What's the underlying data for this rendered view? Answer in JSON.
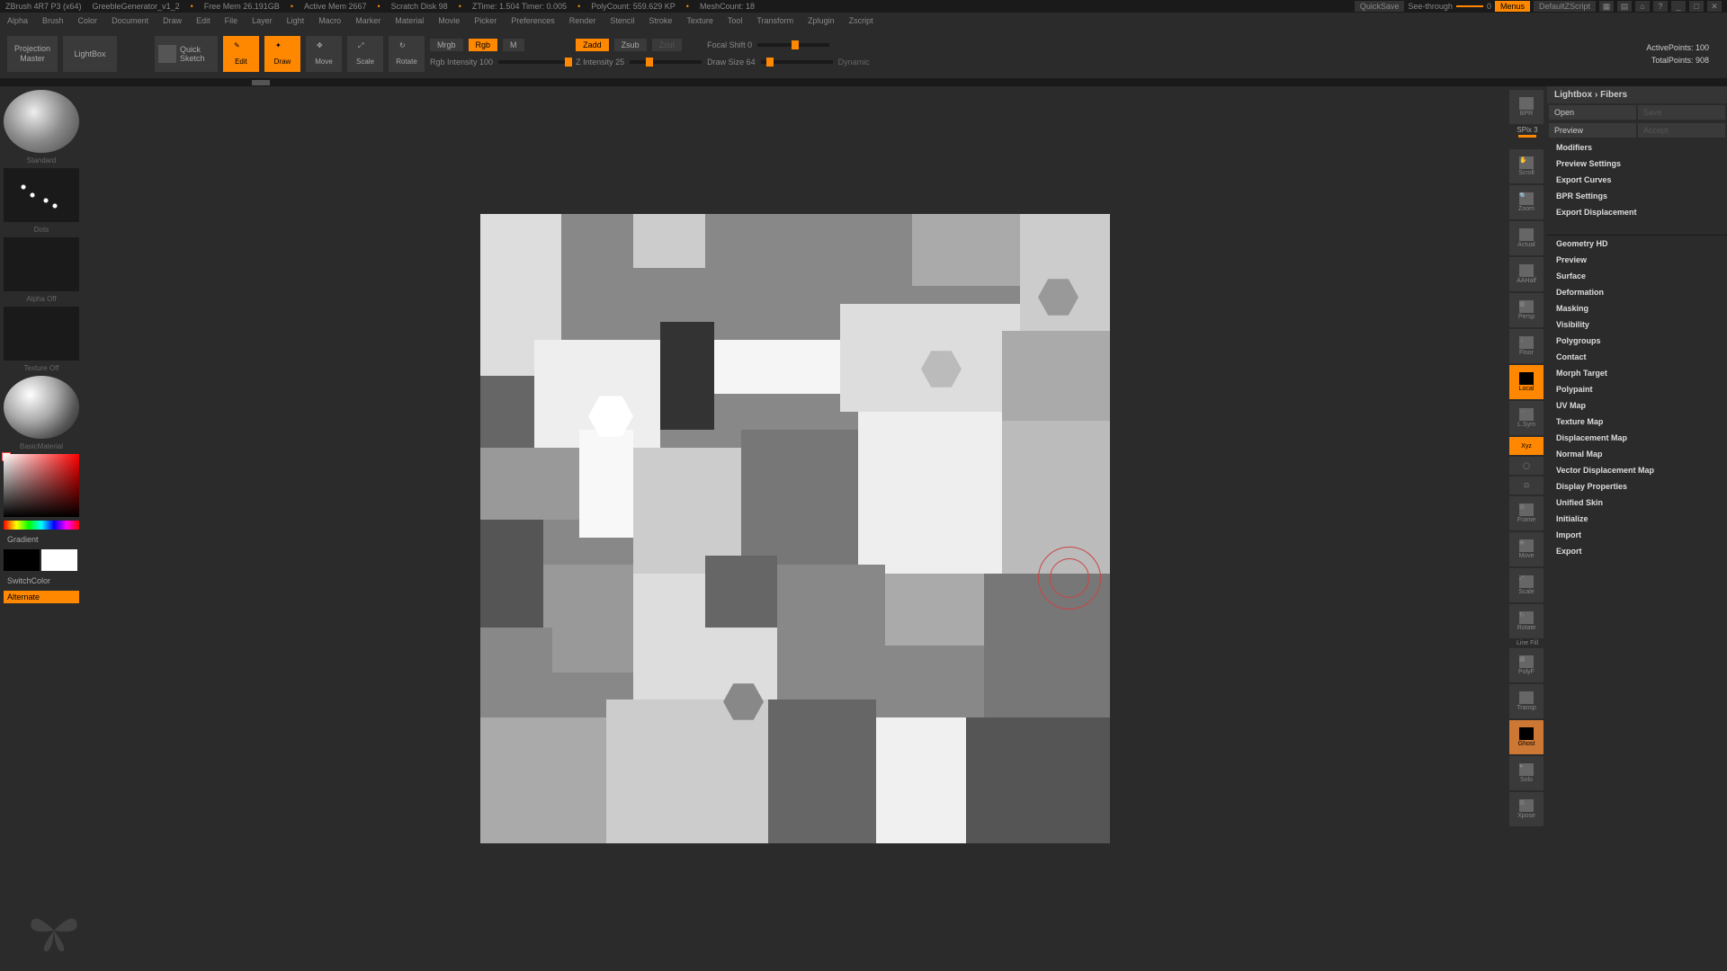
{
  "titlebar": {
    "app": "ZBrush 4R7 P3 (x64)",
    "project": "GreebleGenerator_v1_2",
    "free_mem": "Free Mem 26.191GB",
    "active_mem": "Active Mem 2667",
    "scratch": "Scratch Disk 98",
    "ztime": "ZTime: 1.504 Timer: 0.005",
    "polycount": "PolyCount: 559.629 KP",
    "meshcount": "MeshCount: 18",
    "quicksave": "QuickSave",
    "seethrough": "See-through",
    "seethrough_val": "0",
    "menus": "Menus",
    "script": "DefaultZScript"
  },
  "menu": [
    "Alpha",
    "Brush",
    "Color",
    "Document",
    "Draw",
    "Edit",
    "File",
    "Layer",
    "Light",
    "Macro",
    "Marker",
    "Material",
    "Movie",
    "Picker",
    "Preferences",
    "Render",
    "Stencil",
    "Stroke",
    "Texture",
    "Tool",
    "Transform",
    "Zplugin",
    "Zscript"
  ],
  "header": {
    "projection": "Projection\nMaster",
    "lightbox": "LightBox",
    "quicksketch": "Quick\nSketch",
    "modes": [
      "Edit",
      "Draw",
      "Move",
      "Scale",
      "Rotate"
    ],
    "mrgb": "Mrgb",
    "rgb": "Rgb",
    "m": "M",
    "rgb_intensity": "Rgb Intensity",
    "rgb_intensity_val": "100",
    "zadd": "Zadd",
    "zsub": "Zsub",
    "zcut": "Zcut",
    "z_intensity": "Z Intensity",
    "z_intensity_val": "25",
    "focal_shift": "Focal Shift",
    "focal_shift_val": "0",
    "draw_size": "Draw Size",
    "draw_size_val": "64",
    "dynamic": "Dynamic",
    "active_points": "ActivePoints:",
    "active_points_val": "100",
    "total_points": "TotalPoints:",
    "total_points_val": "908"
  },
  "left": {
    "brush": "Standard",
    "stroke": "Dots",
    "alpha": "Alpha Off",
    "texture": "Texture Off",
    "material": "BasicMaterial",
    "gradient": "Gradient",
    "switchcolor": "SwitchColor",
    "alternate": "Alternate"
  },
  "right_shelf": {
    "bpr": "BPR",
    "spix": "SPix",
    "spix_val": "3",
    "items": [
      "Scroll",
      "Zoom",
      "Actual",
      "AAHalf",
      "Persp",
      "Floor",
      "Local",
      "L.Sym",
      "Xyz",
      "",
      "",
      "Frame",
      "Move",
      "Scale",
      "Rotate",
      "Line Fill",
      "PolyF",
      "Transp",
      "Ghost",
      "Solo",
      "Xpose"
    ]
  },
  "right_panel": {
    "header": "Lightbox › Fibers",
    "open": "Open",
    "save": "Save",
    "preview": "Preview",
    "accept": "Accept",
    "modifiers": "Modifiers",
    "preview_settings": "Preview Settings",
    "export_curves": "Export Curves",
    "bpr_settings": "BPR Settings",
    "export_disp": "Export Displacement",
    "sections": [
      "Geometry HD",
      "Preview",
      "Surface",
      "Deformation",
      "Masking",
      "Visibility",
      "Polygroups",
      "Contact",
      "Morph Target",
      "Polypaint",
      "UV Map",
      "Texture Map",
      "Displacement Map",
      "Normal Map",
      "Vector Displacement Map",
      "Display Properties",
      "Unified Skin",
      "Initialize",
      "Import",
      "Export"
    ]
  }
}
